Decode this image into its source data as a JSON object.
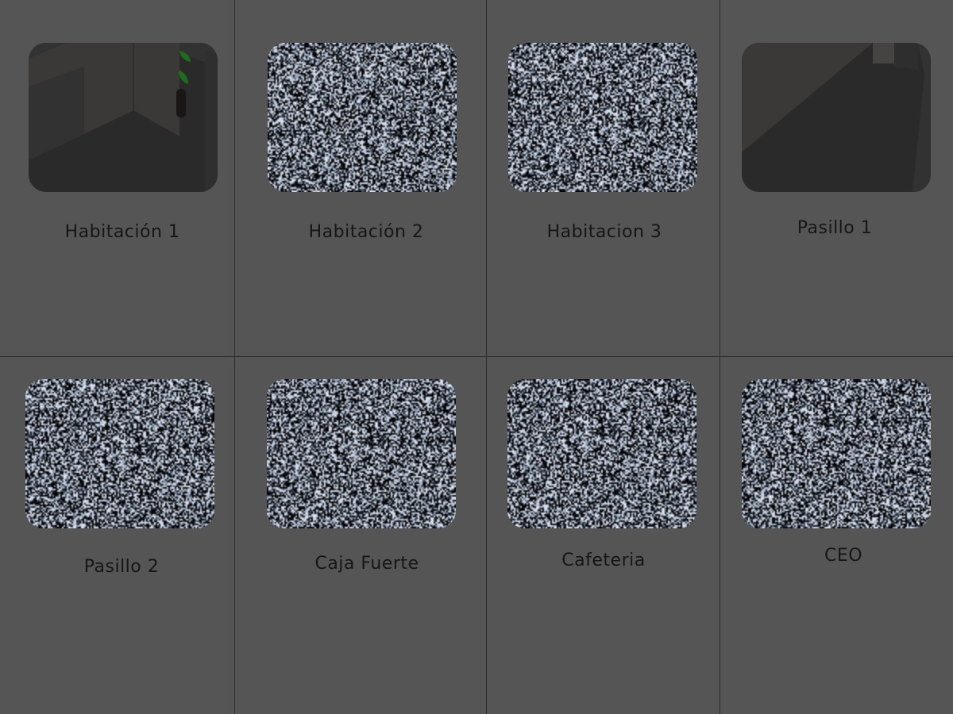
{
  "colors": {
    "background": "#555555",
    "divider": "#2c2c2c",
    "label": "#161616",
    "room_dark": "#2a2a2a",
    "room_mid": "#3a3938",
    "plant_leaf": "#1e6e1e"
  },
  "cameras": [
    {
      "label": "Habitación 1",
      "feed": "room-view-1",
      "icon": "camera-feed-icon"
    },
    {
      "label": "Habitación 2",
      "feed": "static-noise",
      "icon": "camera-feed-icon"
    },
    {
      "label": "Habitacion 3",
      "feed": "static-noise",
      "icon": "camera-feed-icon"
    },
    {
      "label": "Pasillo 1",
      "feed": "hallway-view",
      "icon": "camera-feed-icon"
    },
    {
      "label": "Pasillo 2",
      "feed": "static-noise",
      "icon": "camera-feed-icon"
    },
    {
      "label": "Caja Fuerte",
      "feed": "static-noise",
      "icon": "camera-feed-icon"
    },
    {
      "label": "Cafeteria",
      "feed": "static-noise",
      "icon": "camera-feed-icon"
    },
    {
      "label": "CEO",
      "feed": "static-noise",
      "icon": "camera-feed-icon"
    }
  ]
}
